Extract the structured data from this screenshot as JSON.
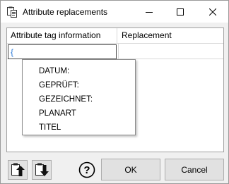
{
  "window": {
    "title": "Attribute replacements",
    "icon": "clipboard-copy-icon"
  },
  "title_buttons": {
    "minimize": "minimize-icon",
    "maximize": "maximize-icon",
    "close": "close-icon"
  },
  "grid": {
    "columns": [
      "Attribute tag information",
      "Replacement"
    ],
    "edit_value": "{",
    "replacement_value": ""
  },
  "autocomplete": {
    "items": [
      "DATUM:",
      "GEPRÜFT:",
      "GEZEICHNET:",
      "PLANART",
      "TITEL"
    ]
  },
  "buttons": {
    "paste_up_icon": "paste-up-icon",
    "paste_down_icon": "paste-down-icon",
    "help_icon": "help-icon",
    "help_glyph": "?",
    "ok": "OK",
    "cancel": "Cancel"
  },
  "colors": {
    "accent_text": "#2b7ad9"
  }
}
